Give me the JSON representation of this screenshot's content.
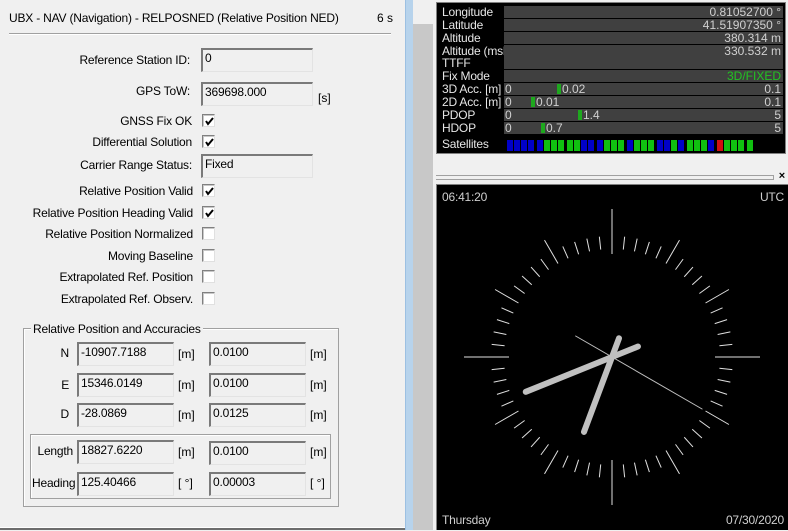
{
  "left_panel": {
    "title": "UBX - NAV (Navigation) - RELPOSNED (Relative Position NED)",
    "age": "6 s",
    "reference_station_id": {
      "label": "Reference Station ID:",
      "value": "0"
    },
    "gps_tow": {
      "label": "GPS ToW:",
      "value": "369698.000",
      "unit": "[s]"
    },
    "flags": [
      {
        "label": "GNSS Fix OK",
        "checked": true
      },
      {
        "label": "Differential Solution",
        "checked": true
      }
    ],
    "carrier_range_status": {
      "label": "Carrier Range Status:",
      "value": "Fixed"
    },
    "flags2": [
      {
        "label": "Relative Position Valid",
        "checked": true
      },
      {
        "label": "Relative Position Heading Valid",
        "checked": true
      },
      {
        "label": "Relative Position Normalized",
        "checked": false
      },
      {
        "label": "Moving Baseline",
        "checked": false
      },
      {
        "label": "Extrapolated Ref. Position",
        "checked": false
      },
      {
        "label": "Extrapolated Ref. Observ.",
        "checked": false
      }
    ],
    "group": {
      "title": "Relative Position and Accuracies",
      "rows": [
        {
          "label": "N",
          "value": "-10907.7188",
          "unit": "[m]",
          "acc": "0.0100",
          "acc_unit": "[m]"
        },
        {
          "label": "E",
          "value": "15346.0149",
          "unit": "[m]",
          "acc": "0.0100",
          "acc_unit": "[m]"
        },
        {
          "label": "D",
          "value": "-28.0869",
          "unit": "[m]",
          "acc": "0.0125",
          "acc_unit": "[m]"
        }
      ],
      "subrows": [
        {
          "label": "Length",
          "value": "18827.6220",
          "unit": "[m]",
          "acc": "0.0100",
          "acc_unit": "[m]"
        },
        {
          "label": "Heading",
          "value": "125.40466",
          "unit": "[ °]",
          "acc": "0.00003",
          "acc_unit": "[ °]"
        }
      ]
    }
  },
  "status_panel": {
    "rows": [
      {
        "label": "Longitude",
        "value": "0.81052700 °"
      },
      {
        "label": "Latitude",
        "value": "41.51907350 °"
      },
      {
        "label": "Altitude",
        "value": "380.314 m"
      },
      {
        "label": "Altitude (msl)",
        "value": "330.532 m"
      },
      {
        "label": "TTFF",
        "value": ""
      },
      {
        "label": "Fix Mode",
        "value": "3D/FIXED",
        "color": "#22c322"
      }
    ],
    "bars": [
      {
        "label": "3D Acc. [m]",
        "min": "0",
        "max": "0.1",
        "value": "0.02",
        "fraction": 0.2
      },
      {
        "label": "2D Acc. [m]",
        "min": "0",
        "max": "0.1",
        "value": "0.01",
        "fraction": 0.1
      },
      {
        "label": "PDOP",
        "min": "0",
        "max": "5",
        "value": "1.4",
        "fraction": 0.28
      },
      {
        "label": "HDOP",
        "min": "0",
        "max": "5",
        "value": "0.7",
        "fraction": 0.14
      }
    ],
    "satellites_label": "Satellites",
    "satellites": [
      "B",
      "B",
      "B",
      "B",
      "B",
      "G",
      "G",
      "G",
      "G",
      "G",
      "B",
      "B",
      "B",
      "G",
      "G",
      "G",
      "B",
      "G",
      "G",
      "G",
      "B",
      "B",
      "G",
      "B",
      "G",
      "G",
      "G",
      "B",
      "R",
      "G",
      "G",
      "G",
      "G"
    ],
    "sat_colors": {
      "B": "#0000c8",
      "G": "#10c010",
      "R": "#d01010"
    }
  },
  "clock_panel": {
    "close_label": "×",
    "time": "06:41:20",
    "timezone": "UTC",
    "weekday": "Thursday",
    "date": "07/30/2020",
    "hands": {
      "hours": 6,
      "minutes": 41,
      "seconds": 20
    }
  }
}
